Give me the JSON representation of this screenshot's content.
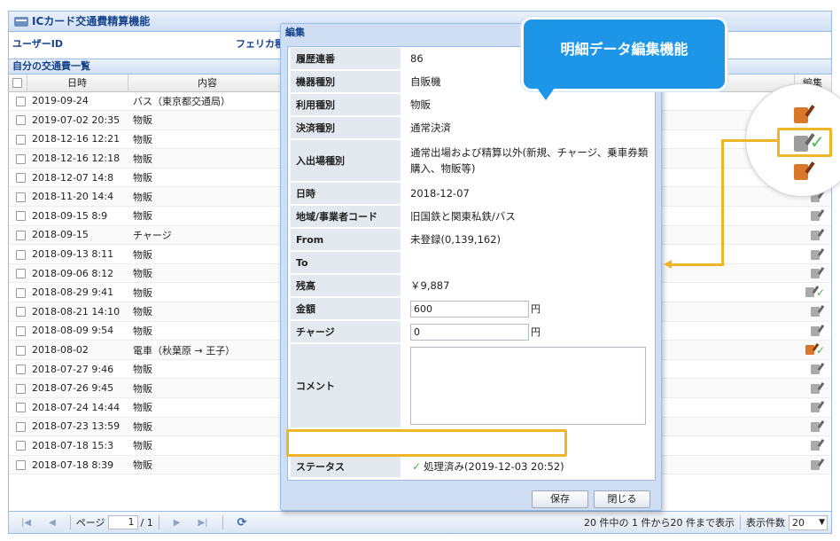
{
  "app": {
    "title": "ICカード交通費精算機能",
    "user_id_label": "ユーザーID",
    "felica_label": "フェリカ種"
  },
  "grid": {
    "title": "自分の交通費一覧",
    "columns": {
      "date": "日時",
      "content": "内容",
      "edit": "編集"
    },
    "rows": [
      {
        "date": "2019-09-24",
        "content": "バス（東京都交通局）",
        "icon": "orange",
        "check": false
      },
      {
        "date": "2019-07-02 20:35",
        "content": "物販",
        "icon": "grey",
        "check": false
      },
      {
        "date": "2018-12-16 12:21",
        "content": "物販",
        "icon": "orange",
        "check": false
      },
      {
        "date": "2018-12-16 12:18",
        "content": "物販",
        "icon": "grey",
        "check": false
      },
      {
        "date": "2018-12-07 14:8",
        "content": "物販",
        "icon": "grey",
        "check": true
      },
      {
        "date": "2018-11-20 14:4",
        "content": "物販",
        "icon": "grey",
        "check": false
      },
      {
        "date": "2018-09-15 8:9",
        "content": "物販",
        "icon": "grey",
        "check": false
      },
      {
        "date": "2018-09-15",
        "content": "チャージ",
        "icon": "grey",
        "check": false
      },
      {
        "date": "2018-09-13 8:11",
        "content": "物販",
        "icon": "grey",
        "check": false
      },
      {
        "date": "2018-09-06 8:12",
        "content": "物販",
        "icon": "grey",
        "check": false
      },
      {
        "date": "2018-08-29 9:41",
        "content": "物販",
        "icon": "grey",
        "check": true
      },
      {
        "date": "2018-08-21 14:10",
        "content": "物販",
        "icon": "grey",
        "check": false
      },
      {
        "date": "2018-08-09 9:54",
        "content": "物販",
        "icon": "grey",
        "check": false
      },
      {
        "date": "2018-08-02",
        "content": "電車（秋葉原 → 王子）",
        "icon": "orange",
        "check": true
      },
      {
        "date": "2018-07-27 9:46",
        "content": "物販",
        "icon": "grey",
        "check": false
      },
      {
        "date": "2018-07-26 9:45",
        "content": "物販",
        "icon": "grey",
        "check": false
      },
      {
        "date": "2018-07-24 14:44",
        "content": "物販",
        "icon": "grey",
        "check": false
      },
      {
        "date": "2018-07-23 13:59",
        "content": "物販",
        "icon": "grey",
        "check": false
      },
      {
        "date": "2018-07-18 15:3",
        "content": "物販",
        "icon": "grey",
        "check": false
      },
      {
        "date": "2018-07-18 8:39",
        "content": "物販",
        "icon": "grey",
        "check": false
      }
    ]
  },
  "pager": {
    "page_label": "ページ",
    "page_value": "1",
    "page_total": "/ 1",
    "summary": "20 件中の 1 件から20 件まで表示",
    "per_page_label": "表示件数",
    "per_page_value": "20"
  },
  "dialog": {
    "title": "編集",
    "fields": {
      "history_no": {
        "label": "履歴連番",
        "value": "86"
      },
      "device_type": {
        "label": "機器種別",
        "value": "自販機"
      },
      "usage_type": {
        "label": "利用種別",
        "value": "物販"
      },
      "payment_type": {
        "label": "決済種別",
        "value": "通常決済"
      },
      "entry_type": {
        "label": "入出場種別",
        "value": "通常出場および精算以外(新規、チャージ、乗車券類購入、物販等)"
      },
      "datetime": {
        "label": "日時",
        "value": "2018-12-07"
      },
      "region": {
        "label": "地域/事業者コード",
        "value": "旧国鉄と関東私鉄/バス"
      },
      "from": {
        "label": "From",
        "value": "未登録(0,139,162)"
      },
      "to": {
        "label": "To",
        "value": ""
      },
      "balance": {
        "label": "残高",
        "value": "￥9,887"
      },
      "amount": {
        "label": "金額",
        "value": "600",
        "unit": "円"
      },
      "charge": {
        "label": "チャージ",
        "value": "0",
        "unit": "円"
      },
      "comment": {
        "label": "コメント",
        "value": ""
      },
      "status": {
        "label": "ステータス",
        "value": "処理済み(2019-12-03 20:52)"
      }
    },
    "save_label": "保存",
    "close_label": "閉じる"
  },
  "callout": {
    "text": "明細データ編集機能"
  },
  "colors": {
    "accent": "#1e96e8",
    "highlight": "#f0b429",
    "panel_header": "#15428b"
  },
  "icons": {
    "edit": "pencil-edit-icon",
    "check": "check-icon",
    "refresh": "refresh-icon"
  }
}
